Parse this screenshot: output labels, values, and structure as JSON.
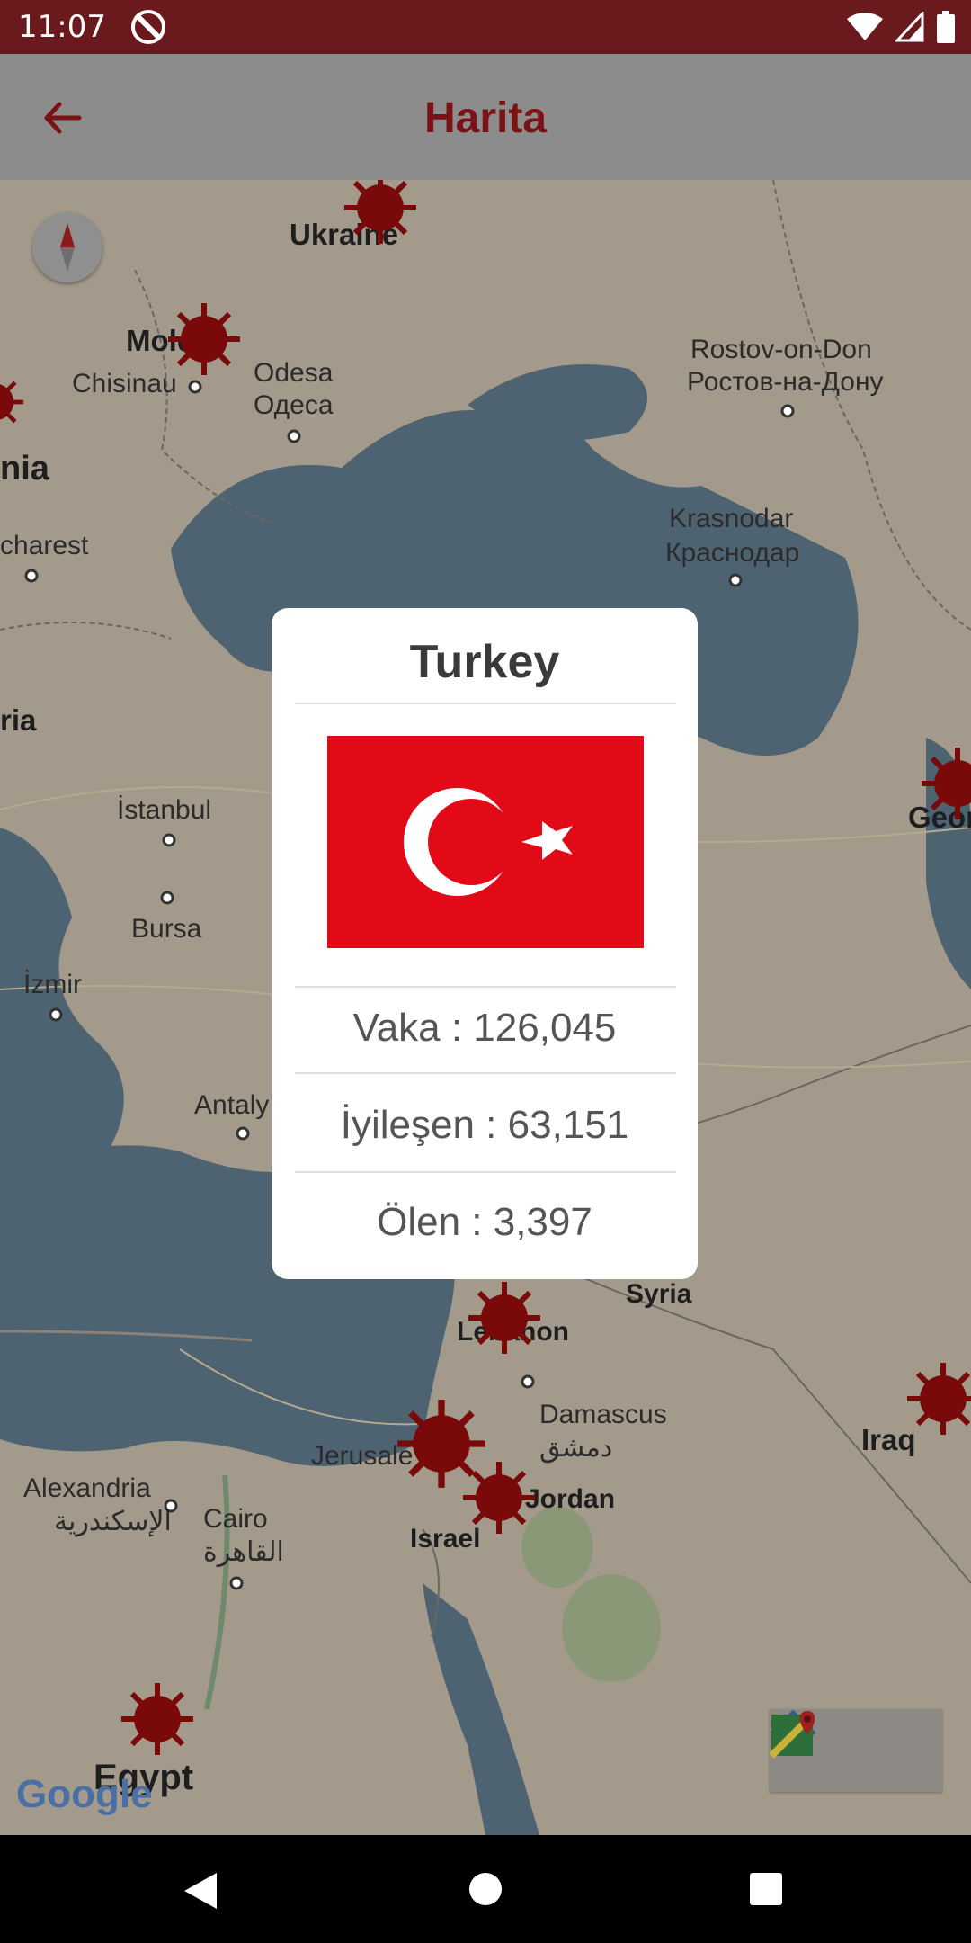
{
  "status_bar": {
    "time": "11:07",
    "icons": [
      "vpn-icon",
      "wifi-icon",
      "signal-icon",
      "battery-icon"
    ]
  },
  "app_bar": {
    "title": "Harita",
    "back_icon": "arrow-left-icon"
  },
  "map": {
    "labels": {
      "ukraine": "Ukraine",
      "moldova": "Mold",
      "chisinau": "Chisinau",
      "odesa": "Odesa",
      "odesa_cyr": "Одеса",
      "romania": "nia",
      "bucharest": "charest",
      "bulgaria": "ria",
      "rostov": "Rostov-on-Don",
      "rostov_cyr": "Ростов-на-Дону",
      "krasnodar": "Krasnodar",
      "krasnodar_cyr": "Краснодар",
      "georgia": "Geor",
      "istanbul": "İstanbul",
      "bursa": "Bursa",
      "izmir": "İzmir",
      "antalya": "Antaly",
      "syria": "Syria",
      "lebanon": "Lebanon",
      "damascus": "Damascus",
      "damascus_ar": "دمشق",
      "iraq": "Iraq",
      "jerusalem": "Jerusale",
      "jordan": "Jordan",
      "israel": "Israel",
      "alexandria": "Alexandria",
      "alexandria_ar": "الإسكندرية",
      "cairo": "Cairo",
      "cairo_ar": "القاهرة",
      "egypt": "Egypt"
    },
    "google_logo": "Google",
    "marker_icon": "virus-icon",
    "tools": [
      "directions-icon",
      "google-maps-icon"
    ]
  },
  "dialog": {
    "country": "Turkey",
    "flag_icon": "turkey-flag-icon",
    "cases": "Vaka : 126,045",
    "recovered": "İyileşen : 63,151",
    "deaths": "Ölen : 3,397"
  },
  "colors": {
    "status_bar": "#6a1a1c",
    "accent": "#7b1216",
    "flag_red": "#e30a17"
  }
}
